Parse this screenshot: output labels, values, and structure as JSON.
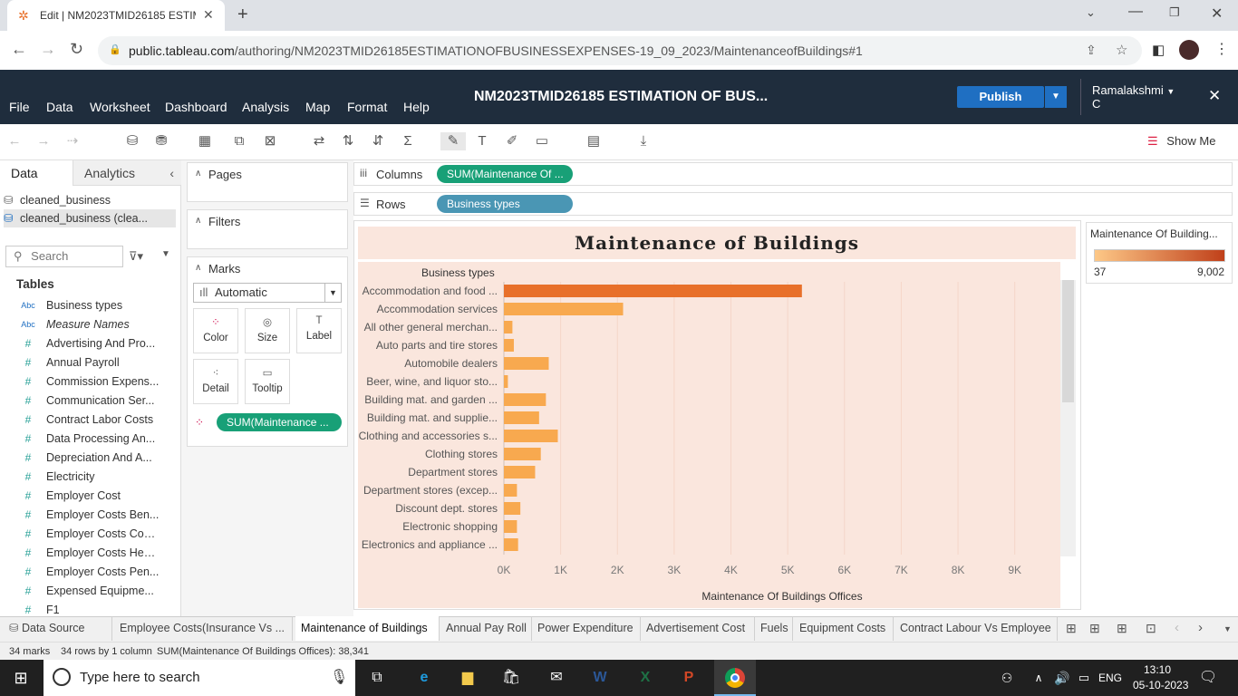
{
  "browser": {
    "tab_title": "Edit | NM2023TMID26185 ESTIM",
    "url_host": "public.tableau.com",
    "url_path": "/authoring/NM2023TMID26185ESTIMATIONOFBUSINESSEXPENSES-19_09_2023/MaintenanceofBuildings#1"
  },
  "app": {
    "menu": [
      "File",
      "Data",
      "Worksheet",
      "Dashboard",
      "Analysis",
      "Map",
      "Format",
      "Help"
    ],
    "workbook_title": "NM2023TMID26185 ESTIMATION OF BUS...",
    "publish_label": "Publish",
    "user_name": "Ramalakshmi",
    "user_initial": "C",
    "show_me": "Show Me"
  },
  "left_pane": {
    "tab_data": "Data",
    "tab_analytics": "Analytics",
    "datasources": [
      "cleaned_business",
      "cleaned_business (clea..."
    ],
    "search_placeholder": "Search",
    "tables_heading": "Tables",
    "fields": [
      {
        "type": "Abc",
        "name": "Business types",
        "italic": false
      },
      {
        "type": "Abc",
        "name": "Measure Names",
        "italic": true
      },
      {
        "type": "#",
        "name": "Advertising And Pro...",
        "italic": false
      },
      {
        "type": "#",
        "name": "Annual Payroll",
        "italic": false
      },
      {
        "type": "#",
        "name": "Commission Expens...",
        "italic": false
      },
      {
        "type": "#",
        "name": "Communication Ser...",
        "italic": false
      },
      {
        "type": "#",
        "name": "Contract Labor Costs",
        "italic": false
      },
      {
        "type": "#",
        "name": "Data Processing An...",
        "italic": false
      },
      {
        "type": "#",
        "name": "Depreciation And A...",
        "italic": false
      },
      {
        "type": "#",
        "name": "Electricity",
        "italic": false
      },
      {
        "type": "#",
        "name": "Employer Cost",
        "italic": false
      },
      {
        "type": "#",
        "name": "Employer Costs Ben...",
        "italic": false
      },
      {
        "type": "#",
        "name": "Employer Costs Con...",
        "italic": false
      },
      {
        "type": "#",
        "name": "Employer Costs Hea...",
        "italic": false
      },
      {
        "type": "#",
        "name": "Employer Costs Pen...",
        "italic": false
      },
      {
        "type": "#",
        "name": "Expensed Equipme...",
        "italic": false
      },
      {
        "type": "#",
        "name": "F1",
        "italic": false
      }
    ]
  },
  "cards": {
    "pages": "Pages",
    "filters": "Filters",
    "marks": "Marks",
    "mark_type": "Automatic",
    "mark_buttons": [
      "Color",
      "Size",
      "Label",
      "Detail",
      "Tooltip"
    ],
    "mark_pill": "SUM(Maintenance ..."
  },
  "shelves": {
    "columns_label": "Columns",
    "columns_pill": "SUM(Maintenance Of ...",
    "rows_label": "Rows",
    "rows_pill": "Business types"
  },
  "legend": {
    "title": "Maintenance Of Building...",
    "min": "37",
    "max": "9,002",
    "color_low": "#fdc887",
    "color_high": "#c0401a"
  },
  "chart_data": {
    "type": "bar",
    "title": "Maintenance of Buildings",
    "row_header": "Business types",
    "xlabel": "Maintenance Of Buildings Offices",
    "xticks": [
      "0K",
      "1K",
      "2K",
      "3K",
      "4K",
      "5K",
      "6K",
      "7K",
      "8K",
      "9K"
    ],
    "xlim": [
      0,
      9500
    ],
    "categories": [
      "Accommodation and food ...",
      "Accommodation services",
      "All other general merchan...",
      "Auto parts and tire stores",
      "Automobile dealers",
      "Beer, wine, and liquor sto...",
      "Building mat. and garden ...",
      "Building mat. and supplie...",
      "Clothing and accessories s...",
      "Clothing stores",
      "Department stores",
      "Department stores (excep...",
      "Discount dept. stores",
      "Electronic shopping",
      "Electronics and appliance ..."
    ],
    "values": [
      5250,
      2100,
      150,
      175,
      790,
      70,
      740,
      620,
      950,
      650,
      550,
      230,
      290,
      230,
      250
    ],
    "bar_color_high": "#e8702a",
    "bar_color_low": "#f8a94f",
    "background": "#fae6dd"
  },
  "sheet_tabs": {
    "data_source": "Data Source",
    "tabs": [
      "Employee Costs(Insurance Vs ...",
      "Maintenance of Buildings",
      "Annual Pay Roll",
      "Power Expenditure",
      "Advertisement Cost",
      "Fuels",
      "Equipment Costs",
      "Contract Labour Vs Employee"
    ],
    "active_index": 1
  },
  "status": {
    "marks": "34 marks",
    "rows": "34 rows by 1 column",
    "sum": "SUM(Maintenance Of Buildings Offices): 38,341"
  },
  "taskbar": {
    "search_placeholder": "Type here to search",
    "lang": "ENG",
    "time": "13:10",
    "date": "05-10-2023"
  }
}
